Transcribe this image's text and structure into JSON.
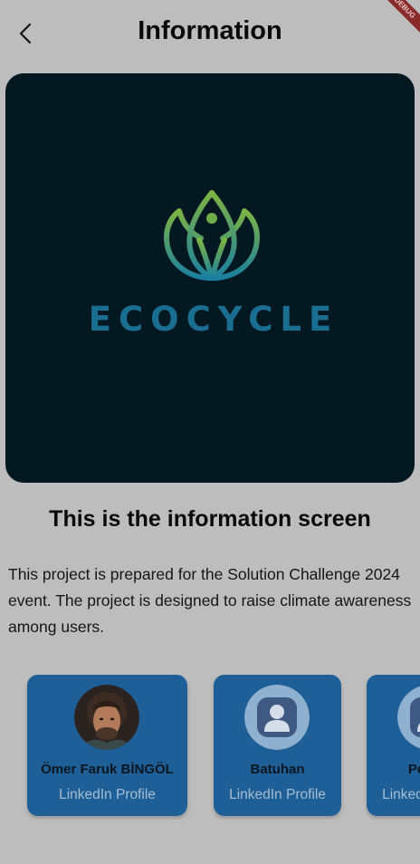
{
  "appbar": {
    "title": "Information",
    "back_icon": "chevron-left-icon",
    "debug_banner": "DEBUG"
  },
  "logo": {
    "wordmark": "ECOCYCLE",
    "mark_icon": "lotus-leaf-icon",
    "colors": {
      "background": "#031820",
      "mark_gradient_start": "#7cb342",
      "mark_gradient_end": "#1a7fa0",
      "wordmark": "#1a6e92"
    }
  },
  "main": {
    "heading": "This is the information screen",
    "description": "This project is prepared for the Solution Challenge 2024 event. The project is designed to raise climate awareness among users."
  },
  "team": {
    "members": [
      {
        "name": "Ömer Faruk BİNGÖL",
        "link": "LinkedIn Profile",
        "avatar": "photo-avatar"
      },
      {
        "name": "Batuhan",
        "link": "LinkedIn Profile",
        "avatar": "person-placeholder-icon"
      },
      {
        "name": "Pembe",
        "link": "LinkedIn Profile",
        "avatar": "person-placeholder-icon"
      }
    ]
  },
  "colors": {
    "card": "#1d5f96",
    "overlay": "#bdbdbd"
  }
}
